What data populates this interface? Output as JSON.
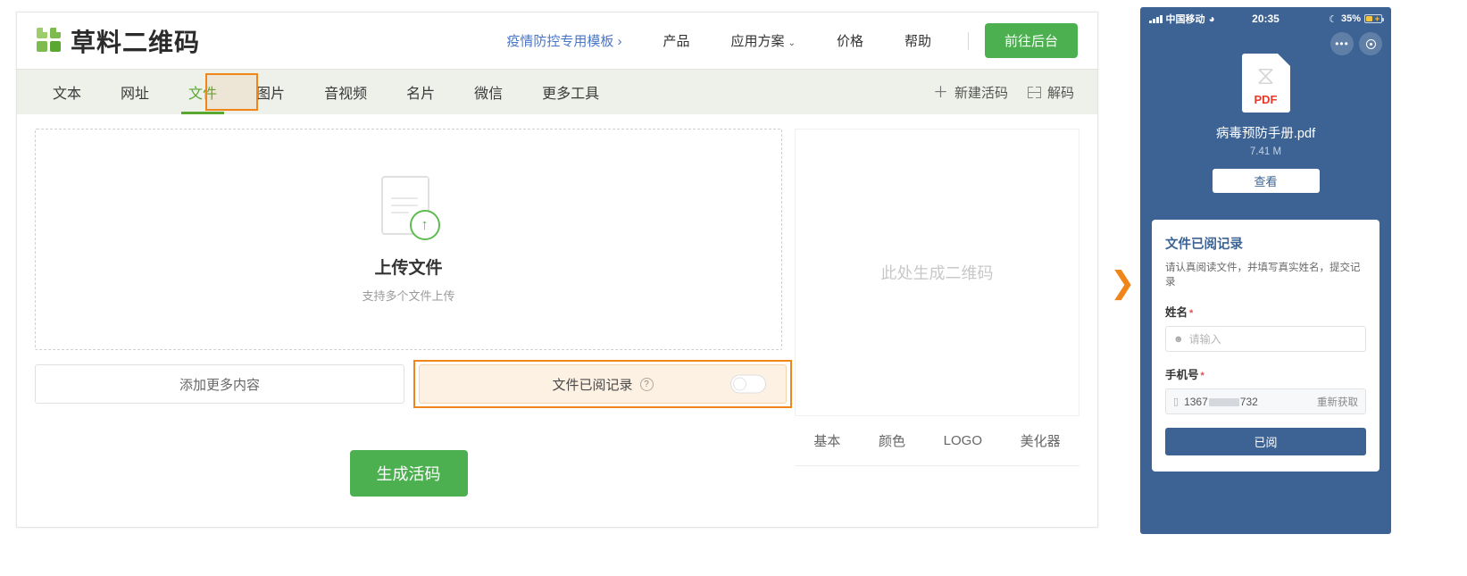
{
  "header": {
    "logo_text": "草料二维码",
    "nav": [
      {
        "label": "疫情防控专用模板 ›",
        "promo": true
      },
      {
        "label": "产品",
        "promo": false
      },
      {
        "label": "应用方案",
        "promo": false,
        "caret": true
      },
      {
        "label": "价格",
        "promo": false
      },
      {
        "label": "帮助",
        "promo": false
      }
    ],
    "console_button": "前往后台"
  },
  "tabs": {
    "items": [
      "文本",
      "网址",
      "文件",
      "图片",
      "音视频",
      "名片",
      "微信",
      "更多工具"
    ],
    "active_index": 2,
    "actions": [
      {
        "label": "新建活码",
        "icon": "plus-icon"
      },
      {
        "label": "解码",
        "icon": "decode-icon"
      }
    ]
  },
  "upload": {
    "title": "上传文件",
    "subtitle": "支持多个文件上传",
    "add_more": "添加更多内容",
    "record_label": "文件已阅记录",
    "generate_button": "生成活码"
  },
  "qr_panel": {
    "placeholder": "此处生成二维码",
    "tabs": [
      "基本",
      "颜色",
      "LOGO",
      "美化器"
    ]
  },
  "phone": {
    "status": {
      "carrier": "中国移动",
      "time": "20:35",
      "battery": "35%"
    },
    "file": {
      "type_label": "PDF",
      "name": "病毒预防手册.pdf",
      "size": "7.41 M",
      "view_button": "查看"
    },
    "form": {
      "title": "文件已阅记录",
      "subtitle": "请认真阅读文件，并填写真实姓名，提交记录",
      "name_label": "姓名",
      "name_placeholder": "请输入",
      "phone_label": "手机号",
      "phone_prefix": "1367",
      "phone_suffix": "732",
      "resend": "重新获取",
      "submit": "已阅"
    }
  },
  "colors": {
    "brand_green": "#4caf50",
    "highlight_orange": "#f08519",
    "phone_blue": "#3c6394",
    "link_blue": "#4a76c8"
  }
}
